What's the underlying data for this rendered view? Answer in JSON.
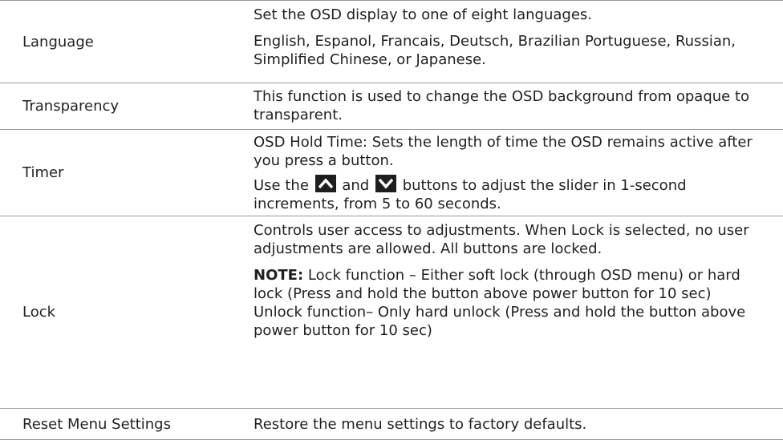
{
  "rows": [
    {
      "label": "Language",
      "paragraphs": [
        "Set the OSD display to one of eight languages.",
        "English, Espanol, Francais, Deutsch, Brazilian Portuguese, Russian, Simplified Chinese, or Japanese."
      ]
    },
    {
      "label": "Transparency",
      "paragraphs": [
        "This function is used to change the OSD background from opaque to transparent."
      ]
    },
    {
      "label": "Timer",
      "paragraphs": [
        "OSD Hold Time: Sets the length of time the OSD remains active after you press a button."
      ],
      "slider_text": {
        "before": "Use the",
        "middle": "and",
        "after": "buttons to adjust the slider in 1-second increments, from 5 to 60 seconds."
      }
    },
    {
      "label": "Lock",
      "paragraphs": [
        "Controls user access to adjustments. When Lock is selected, no user adjustments are allowed. All buttons are locked."
      ],
      "note_label": "NOTE:",
      "note_text": "Lock function – Either soft lock (through OSD menu) or hard lock (Press and hold the button above power button for 10 sec)",
      "unlock_text": "Unlock function– Only hard unlock (Press and hold the button above power button for 10 sec)"
    },
    {
      "label": "Reset Menu Settings",
      "paragraphs": [
        "Restore the menu settings to factory defaults."
      ]
    }
  ],
  "icons": {
    "up": "up-arrow-button-icon",
    "down": "down-arrow-button-icon"
  }
}
